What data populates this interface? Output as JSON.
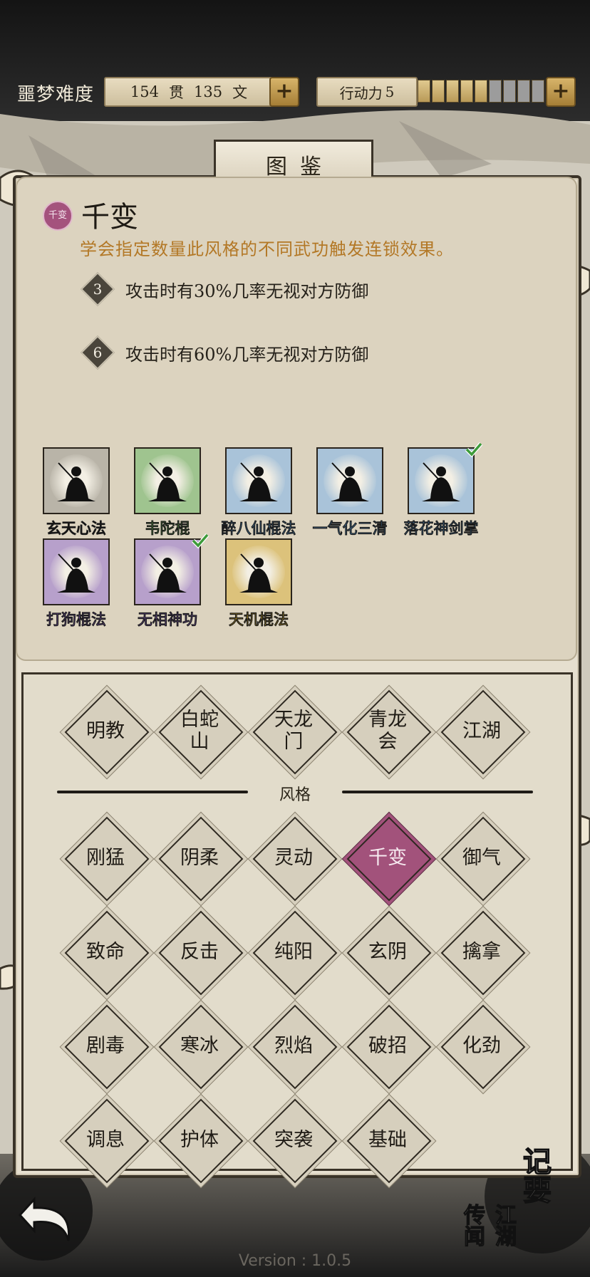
{
  "header": {
    "difficulty": "噩梦难度",
    "currency": {
      "guan_value": "154",
      "guan_unit": "贯",
      "wen_value": "135",
      "wen_unit": "文"
    },
    "action_points": {
      "label": "行动力",
      "value": "5",
      "filled": 5,
      "total": 9
    }
  },
  "panel": {
    "title": "图鉴"
  },
  "style_info": {
    "badge": "千变",
    "name": "千变",
    "description": "学会指定数量此风格的不同武功触发连锁效果。",
    "effects": [
      {
        "count": "3",
        "text": "攻击时有30%几率无视对方防御"
      },
      {
        "count": "6",
        "text": "攻击时有60%几率无视对方防御"
      }
    ]
  },
  "skills": [
    {
      "name": "玄天心法",
      "bg": "#b9b4a8",
      "name_color": "#111111",
      "learned": false
    },
    {
      "name": "韦陀棍",
      "bg": "#9fc48f",
      "name_color": "#5c9a44",
      "learned": false
    },
    {
      "name": "醉八仙棍法",
      "bg": "#a9c3d9",
      "name_color": "#4f86b4",
      "learned": false
    },
    {
      "name": "一气化三清",
      "bg": "#a9c3d9",
      "name_color": "#4f86b4",
      "learned": false
    },
    {
      "name": "落花神剑掌",
      "bg": "#a9c3d9",
      "name_color": "#4f86b4",
      "learned": true
    },
    {
      "name": "打狗棍法",
      "bg": "#b7a0cb",
      "name_color": "#7f58ad",
      "learned": false
    },
    {
      "name": "无相神功",
      "bg": "#b7a0cb",
      "name_color": "#7f58ad",
      "learned": true
    },
    {
      "name": "天机棍法",
      "bg": "#dcc27b",
      "name_color": "#c29a26",
      "learned": false
    }
  ],
  "factions": [
    "明教",
    "白蛇山",
    "天龙门",
    "青龙会",
    "江湖"
  ],
  "style_divider": "风格",
  "styles": [
    {
      "label": "刚猛",
      "selected": false
    },
    {
      "label": "阴柔",
      "selected": false
    },
    {
      "label": "灵动",
      "selected": false
    },
    {
      "label": "千变",
      "selected": true
    },
    {
      "label": "御气",
      "selected": false
    },
    {
      "label": "致命",
      "selected": false
    },
    {
      "label": "反击",
      "selected": false
    },
    {
      "label": "纯阳",
      "selected": false
    },
    {
      "label": "玄阴",
      "selected": false
    },
    {
      "label": "擒拿",
      "selected": false
    },
    {
      "label": "剧毒",
      "selected": false
    },
    {
      "label": "寒冰",
      "selected": false
    },
    {
      "label": "烈焰",
      "selected": false
    },
    {
      "label": "破招",
      "selected": false
    },
    {
      "label": "化劲",
      "selected": false
    },
    {
      "label": "调息",
      "selected": false
    },
    {
      "label": "护体",
      "selected": false
    },
    {
      "label": "突袭",
      "selected": false
    },
    {
      "label": "基础",
      "selected": false
    }
  ],
  "buttons": {
    "notes": "记要",
    "news": "江湖传闻"
  },
  "version": "Version : 1.0.5"
}
